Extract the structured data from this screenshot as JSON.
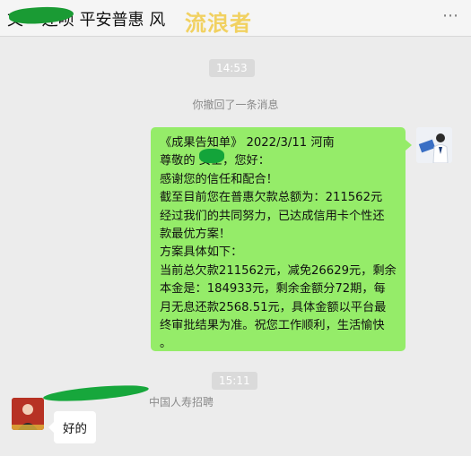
{
  "header": {
    "title": "文 ~还呗 平安普惠 风 ",
    "watermark": "流浪者",
    "menu_icon": "more-icon"
  },
  "messages": {
    "time1": "14:53",
    "recall_notice": "你撤回了一条消息",
    "notice_lines": [
      "《成果告知单》 2022/3/11  河南",
      "尊敬的    女士，您好：",
      "感谢您的信任和配合！",
      "截至目前您在普惠欠款总额为：211562元",
      "经过我们的共同努力，已达成信用卡个性还",
      "款最优方案！",
      "方案具体如下：",
      "当前总欠款211562元，减免26629元，剩余",
      "本金是：184933元，剩余金额分72期，每",
      "月无息还款2568.51元，具体金额以平台最",
      "终审批结果为准。祝您工作顺利，生活愉快",
      "。"
    ],
    "time2": "15:11",
    "sender_name": "中国人寿招聘",
    "reply": "好的"
  },
  "colors": {
    "self_bubble": "#95ec69",
    "other_bubble": "#ffffff",
    "background": "#ececec"
  }
}
